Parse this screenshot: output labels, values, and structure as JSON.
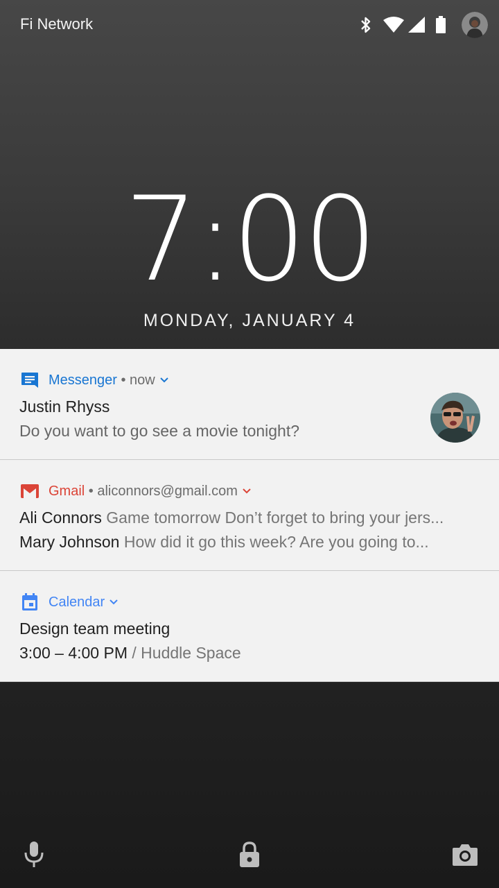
{
  "status_bar": {
    "carrier": "Fi Network",
    "icons": [
      "bluetooth-icon",
      "wifi-icon",
      "signal-icon",
      "battery-icon",
      "avatar"
    ]
  },
  "lockscreen": {
    "time": "7:00",
    "date": "MONDAY, JANUARY 4"
  },
  "notifications": {
    "messenger": {
      "app": "Messenger",
      "meta": " • now",
      "sender": "Justin Rhyss",
      "message": "Do you want to go see a movie tonight?",
      "accent": "#1976d2"
    },
    "gmail": {
      "app": "Gmail",
      "meta": " • aliconnors@gmail.com",
      "accent": "#db4437",
      "rows": [
        {
          "sender": "Ali Connors",
          "preview": " Game tomorrow Don’t forget to bring your jers..."
        },
        {
          "sender": "Mary Johnson",
          "preview": " How did it go this week? Are you going to..."
        }
      ]
    },
    "calendar": {
      "app": "Calendar",
      "accent": "#4285f4",
      "title": "Design team meeting",
      "time": "3:00 – 4:00 PM",
      "location": " / Huddle Space"
    }
  },
  "bottom_bar": {
    "icons": [
      "microphone-icon",
      "lock-icon",
      "camera-icon"
    ]
  }
}
